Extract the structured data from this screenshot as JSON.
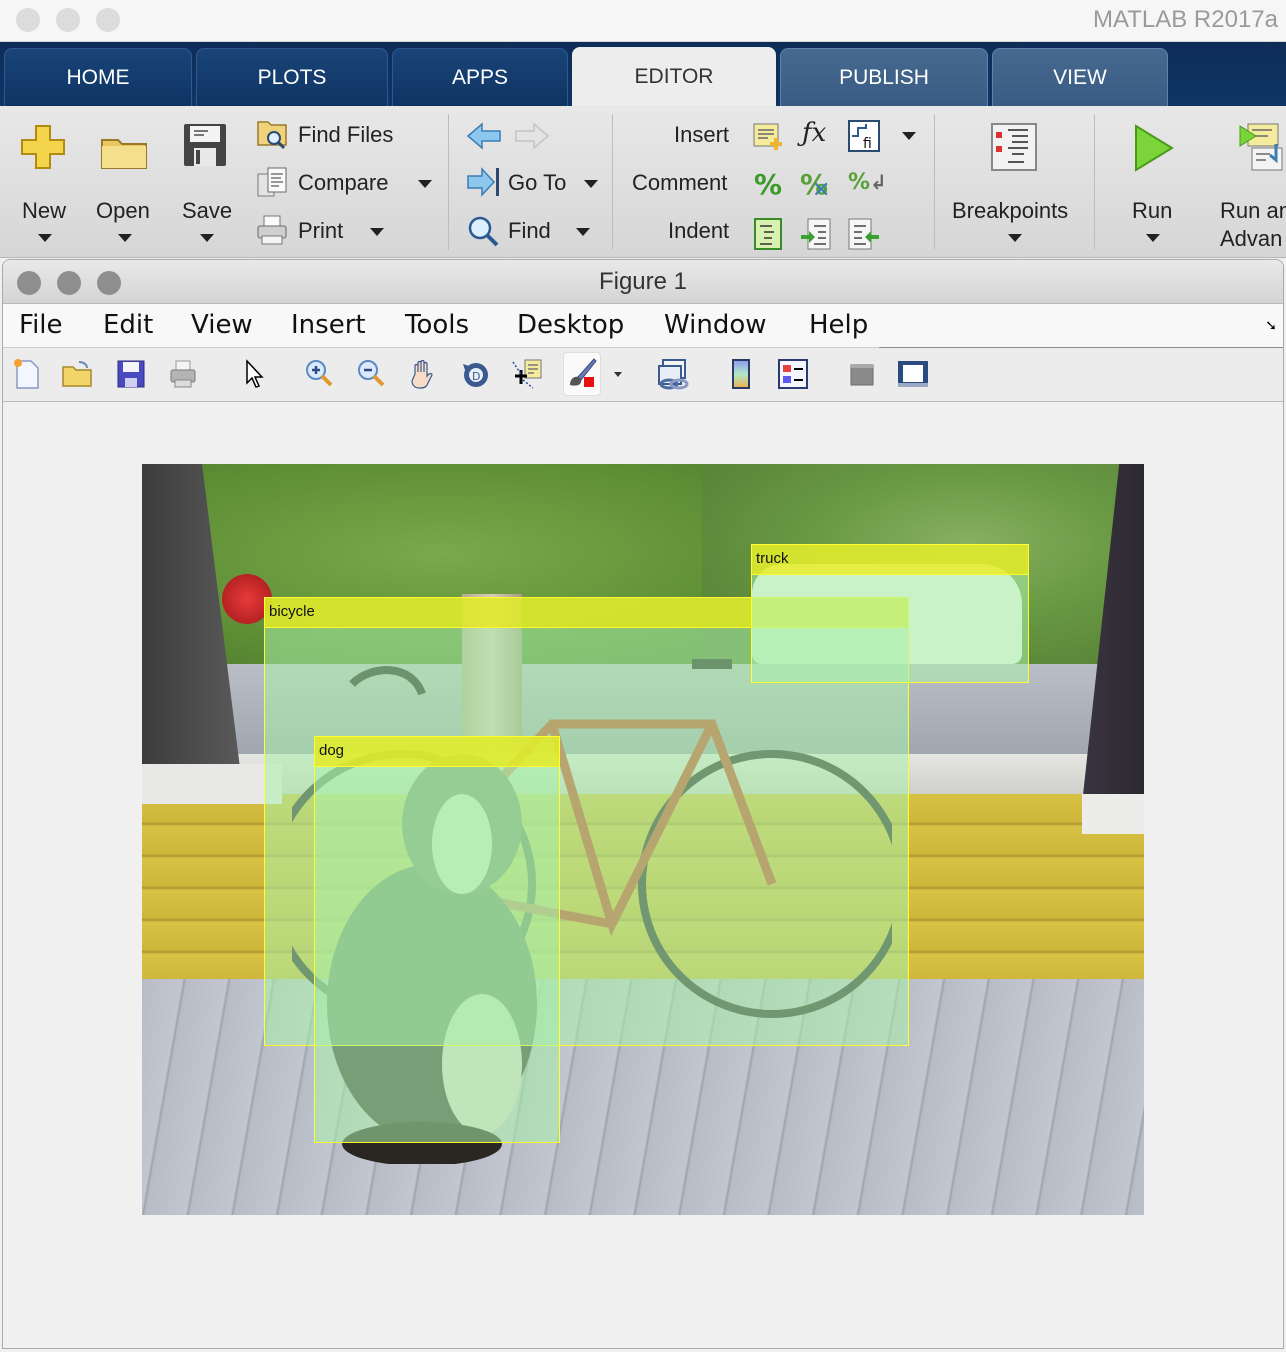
{
  "app": {
    "title": "MATLAB R2017a"
  },
  "tabs": [
    {
      "label": "HOME",
      "active": false
    },
    {
      "label": "PLOTS",
      "active": false
    },
    {
      "label": "APPS",
      "active": false
    },
    {
      "label": "EDITOR",
      "active": true
    },
    {
      "label": "PUBLISH",
      "active": false
    },
    {
      "label": "VIEW",
      "active": false
    }
  ],
  "ribbon": {
    "file": {
      "new": "New",
      "open": "Open",
      "save": "Save",
      "find_files": "Find Files",
      "compare": "Compare",
      "print": "Print"
    },
    "navigate": {
      "go_to": "Go To",
      "find": "Find"
    },
    "edit": {
      "insert": "Insert",
      "comment": "Comment",
      "indent": "Indent"
    },
    "breakpoints": {
      "label": "Breakpoints"
    },
    "run": {
      "run": "Run",
      "run_advance_line1": "Run an",
      "run_advance_line2": "Advan"
    },
    "icons": {
      "new": "plus-icon",
      "open": "folder-icon",
      "save": "floppy-disk-icon",
      "find_files": "folder-search-icon",
      "compare": "compare-documents-icon",
      "print": "printer-icon",
      "back": "arrow-left-icon",
      "forward": "arrow-right-icon",
      "go_to": "go-to-icon",
      "find": "magnifier-icon",
      "insert_section": "insert-section-icon",
      "insert_function": "fx-icon",
      "insert_subfunction": "subfunction-icon",
      "comment": "percent-icon",
      "uncomment": "percent-remove-icon",
      "wrap_comment": "percent-wrap-icon",
      "smart_indent": "smart-indent-icon",
      "increase_indent": "indent-increase-icon",
      "decrease_indent": "indent-decrease-icon",
      "breakpoints": "breakpoints-icon",
      "run": "play-icon",
      "run_advance": "run-advance-icon"
    }
  },
  "figure": {
    "title": "Figure 1",
    "menu": [
      "File",
      "Edit",
      "View",
      "Insert",
      "Tools",
      "Desktop",
      "Window",
      "Help"
    ],
    "toolbar": [
      "new-figure-icon",
      "open-file-icon",
      "save-figure-icon",
      "print-figure-icon",
      "edit-plot-icon",
      "zoom-in-icon",
      "zoom-out-icon",
      "pan-icon",
      "rotate-3d-icon",
      "data-cursor-icon",
      "brush-icon",
      "brush-dropdown-icon",
      "link-plot-icon",
      "colorbar-icon",
      "legend-icon",
      "hide-plot-tools-icon",
      "show-plot-tools-icon"
    ],
    "detections": [
      {
        "label": "bicycle"
      },
      {
        "label": "truck"
      },
      {
        "label": "dog"
      }
    ],
    "colors": {
      "box_edge": "#ffff30",
      "box_fill": "#aaf0aa",
      "label_fill": "#ebeb14"
    }
  }
}
